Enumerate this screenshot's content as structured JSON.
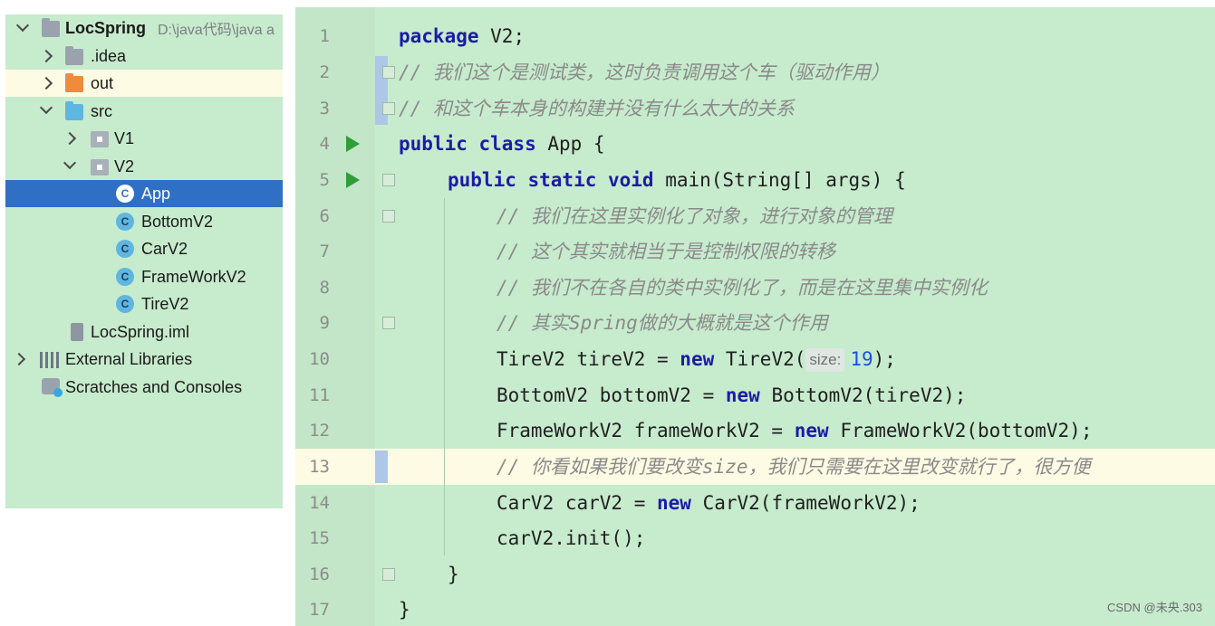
{
  "project_tree": {
    "root": {
      "name": "LocSpring",
      "path": "D:\\java代码\\java a"
    },
    "items": [
      {
        "label": ".idea"
      },
      {
        "label": "out"
      },
      {
        "label": "src"
      },
      {
        "label": "V1"
      },
      {
        "label": "V2"
      },
      {
        "label": "App"
      },
      {
        "label": "BottomV2"
      },
      {
        "label": "CarV2"
      },
      {
        "label": "FrameWorkV2"
      },
      {
        "label": "TireV2"
      },
      {
        "label": "LocSpring.iml"
      },
      {
        "label": "External Libraries"
      },
      {
        "label": "Scratches and Consoles"
      }
    ]
  },
  "editor": {
    "line_numbers": [
      "1",
      "2",
      "3",
      "4",
      "5",
      "6",
      "7",
      "8",
      "9",
      "10",
      "11",
      "12",
      "13",
      "14",
      "15",
      "16",
      "17"
    ],
    "inlay_hint": "size:",
    "lines": {
      "l1_kw": "package",
      "l1_rest": " V2;",
      "l2": "// 我们这个是测试类，这时负责调用这个车（驱动作用）",
      "l3": "// 和这个车本身的构建并没有什么太大的关系",
      "l4_kw": "public class",
      "l4_rest": " App {",
      "l5_kw": "public static void",
      "l5_rest": " main(String[] args) {",
      "l6": "// 我们在这里实例化了对象，进行对象的管理",
      "l7": "// 这个其实就相当于是控制权限的转移",
      "l8": "// 我们不在各自的类中实例化了，而是在这里集中实例化",
      "l9": "// 其实Spring做的大概就是这个作用",
      "l10_a": "TireV2 tireV2 = ",
      "l10_kw": "new",
      "l10_b": " TireV2(",
      "l10_num": "19",
      "l10_c": ");",
      "l11_a": "BottomV2 bottomV2 = ",
      "l11_kw": "new",
      "l11_b": " BottomV2(tireV2);",
      "l12_a": "FrameWorkV2 frameWorkV2 = ",
      "l12_kw": "new",
      "l12_b": " FrameWorkV2(bottomV2);",
      "l13": "// 你看如果我们要改变size，我们只需要在这里改变就行了，很方便",
      "l14_a": "CarV2 carV2 = ",
      "l14_kw": "new",
      "l14_b": " CarV2(frameWorkV2);",
      "l15": "carV2.init();",
      "l16": "}",
      "l17": "}"
    }
  },
  "watermark": "CSDN @未央.303",
  "colors": {
    "background": "#c7ebcd",
    "keyword": "#1c1ca6",
    "comment": "#8a8a8a",
    "selection": "#2f6fc4",
    "caret_line": "#fdfbe3",
    "run": "#2f9e3a"
  }
}
